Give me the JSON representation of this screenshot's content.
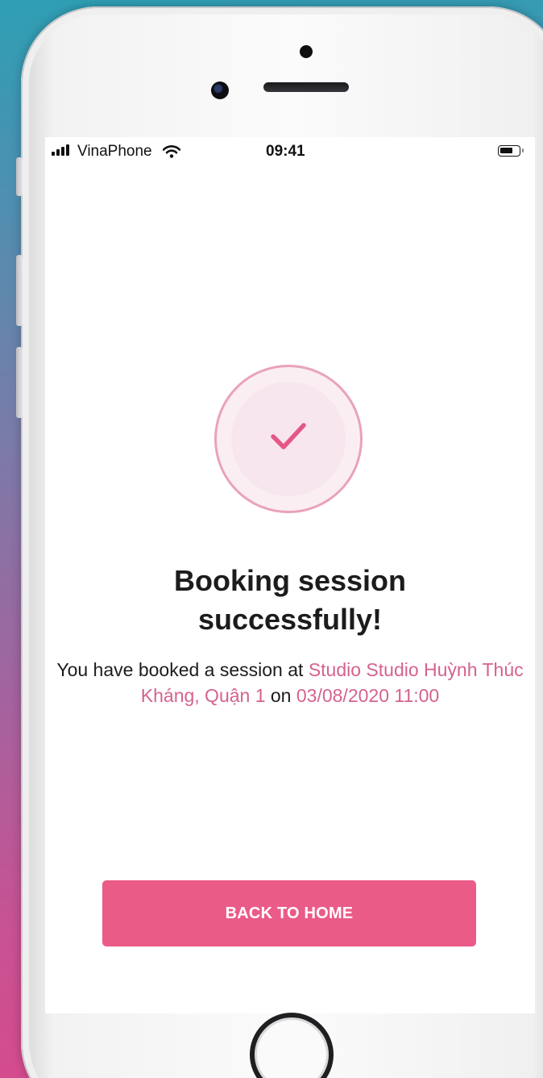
{
  "status_bar": {
    "carrier": "VinaPhone",
    "time": "09:41",
    "signal_icon": "cellular-signal-icon",
    "wifi_icon": "wifi-icon",
    "battery_icon": "battery-icon"
  },
  "success": {
    "icon": "checkmark-icon",
    "title_line1": "Booking session",
    "title_line2": "successfully!",
    "message": {
      "prefix": "You have booked a session at ",
      "studio": "Studio Studio Huỳnh Thúc Kháng, Quận 1",
      "connector": " on ",
      "datetime": "03/08/2020 11:00"
    }
  },
  "actions": {
    "back_home_label": "BACK TO HOME"
  },
  "colors": {
    "accent": "#eb5b88",
    "highlight_text": "#d5628f",
    "circle_border": "#e9a2bd"
  }
}
